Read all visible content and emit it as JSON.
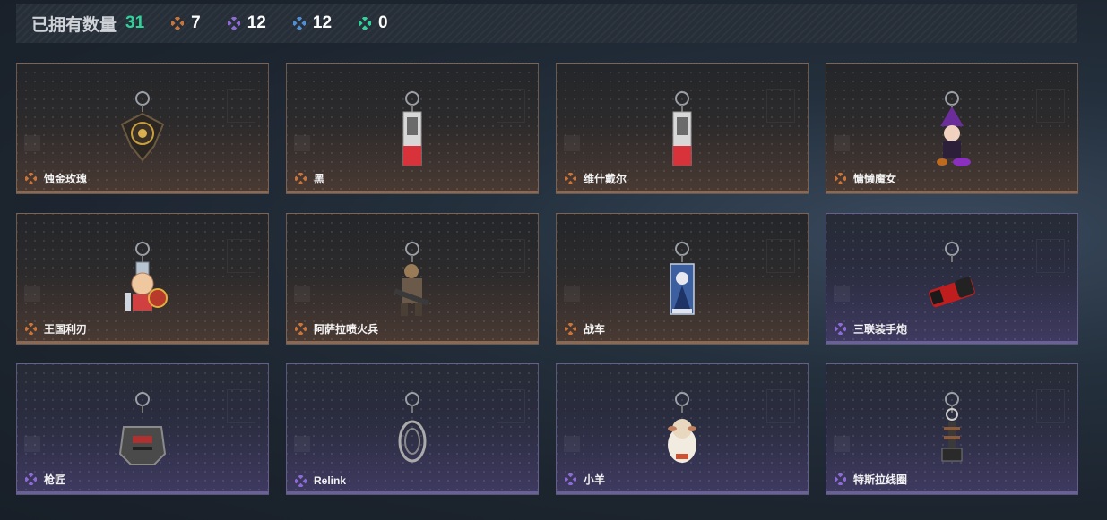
{
  "header": {
    "owned_label": "已拥有数量",
    "owned_count": "31",
    "stats": [
      {
        "icon": "orange-diamond-icon",
        "color": "#c9743a",
        "value": "7"
      },
      {
        "icon": "purple-diamond-icon",
        "color": "#8c6bd6",
        "value": "12"
      },
      {
        "icon": "blue-diamond-icon",
        "color": "#4f8fd8",
        "value": "12"
      },
      {
        "icon": "green-diamond-icon",
        "color": "#2fd39a",
        "value": "0"
      }
    ]
  },
  "colors": {
    "accent_green": "#2fd39a",
    "rarity_gold": "#c9743a",
    "rarity_purple": "#8c6bd6"
  },
  "cards": [
    {
      "name": "蚀金玫瑰",
      "rarity": "gold",
      "art": "rose-pendant-icon"
    },
    {
      "name": "黑",
      "rarity": "gold",
      "art": "card-pendant-icon"
    },
    {
      "name": "维什戴尔",
      "rarity": "gold",
      "art": "card-pendant-icon"
    },
    {
      "name": "慵懒魔女",
      "rarity": "gold",
      "art": "witch-figure-icon"
    },
    {
      "name": "王国利刃",
      "rarity": "gold",
      "art": "knight-figure-icon"
    },
    {
      "name": "阿萨拉喷火兵",
      "rarity": "gold",
      "art": "soldier-figure-icon"
    },
    {
      "name": "战车",
      "rarity": "gold",
      "art": "tarot-card-icon"
    },
    {
      "name": "三联装手炮",
      "rarity": "purple",
      "art": "launcher-pendant-icon"
    },
    {
      "name": "枪匠",
      "rarity": "purple",
      "art": "armor-pendant-icon"
    },
    {
      "name": "Relink",
      "rarity": "purple",
      "art": "emblem-pendant-icon"
    },
    {
      "name": "小羊",
      "rarity": "purple",
      "art": "sheep-figure-icon"
    },
    {
      "name": "特斯拉线圈",
      "rarity": "purple",
      "art": "coil-pendant-icon"
    }
  ]
}
